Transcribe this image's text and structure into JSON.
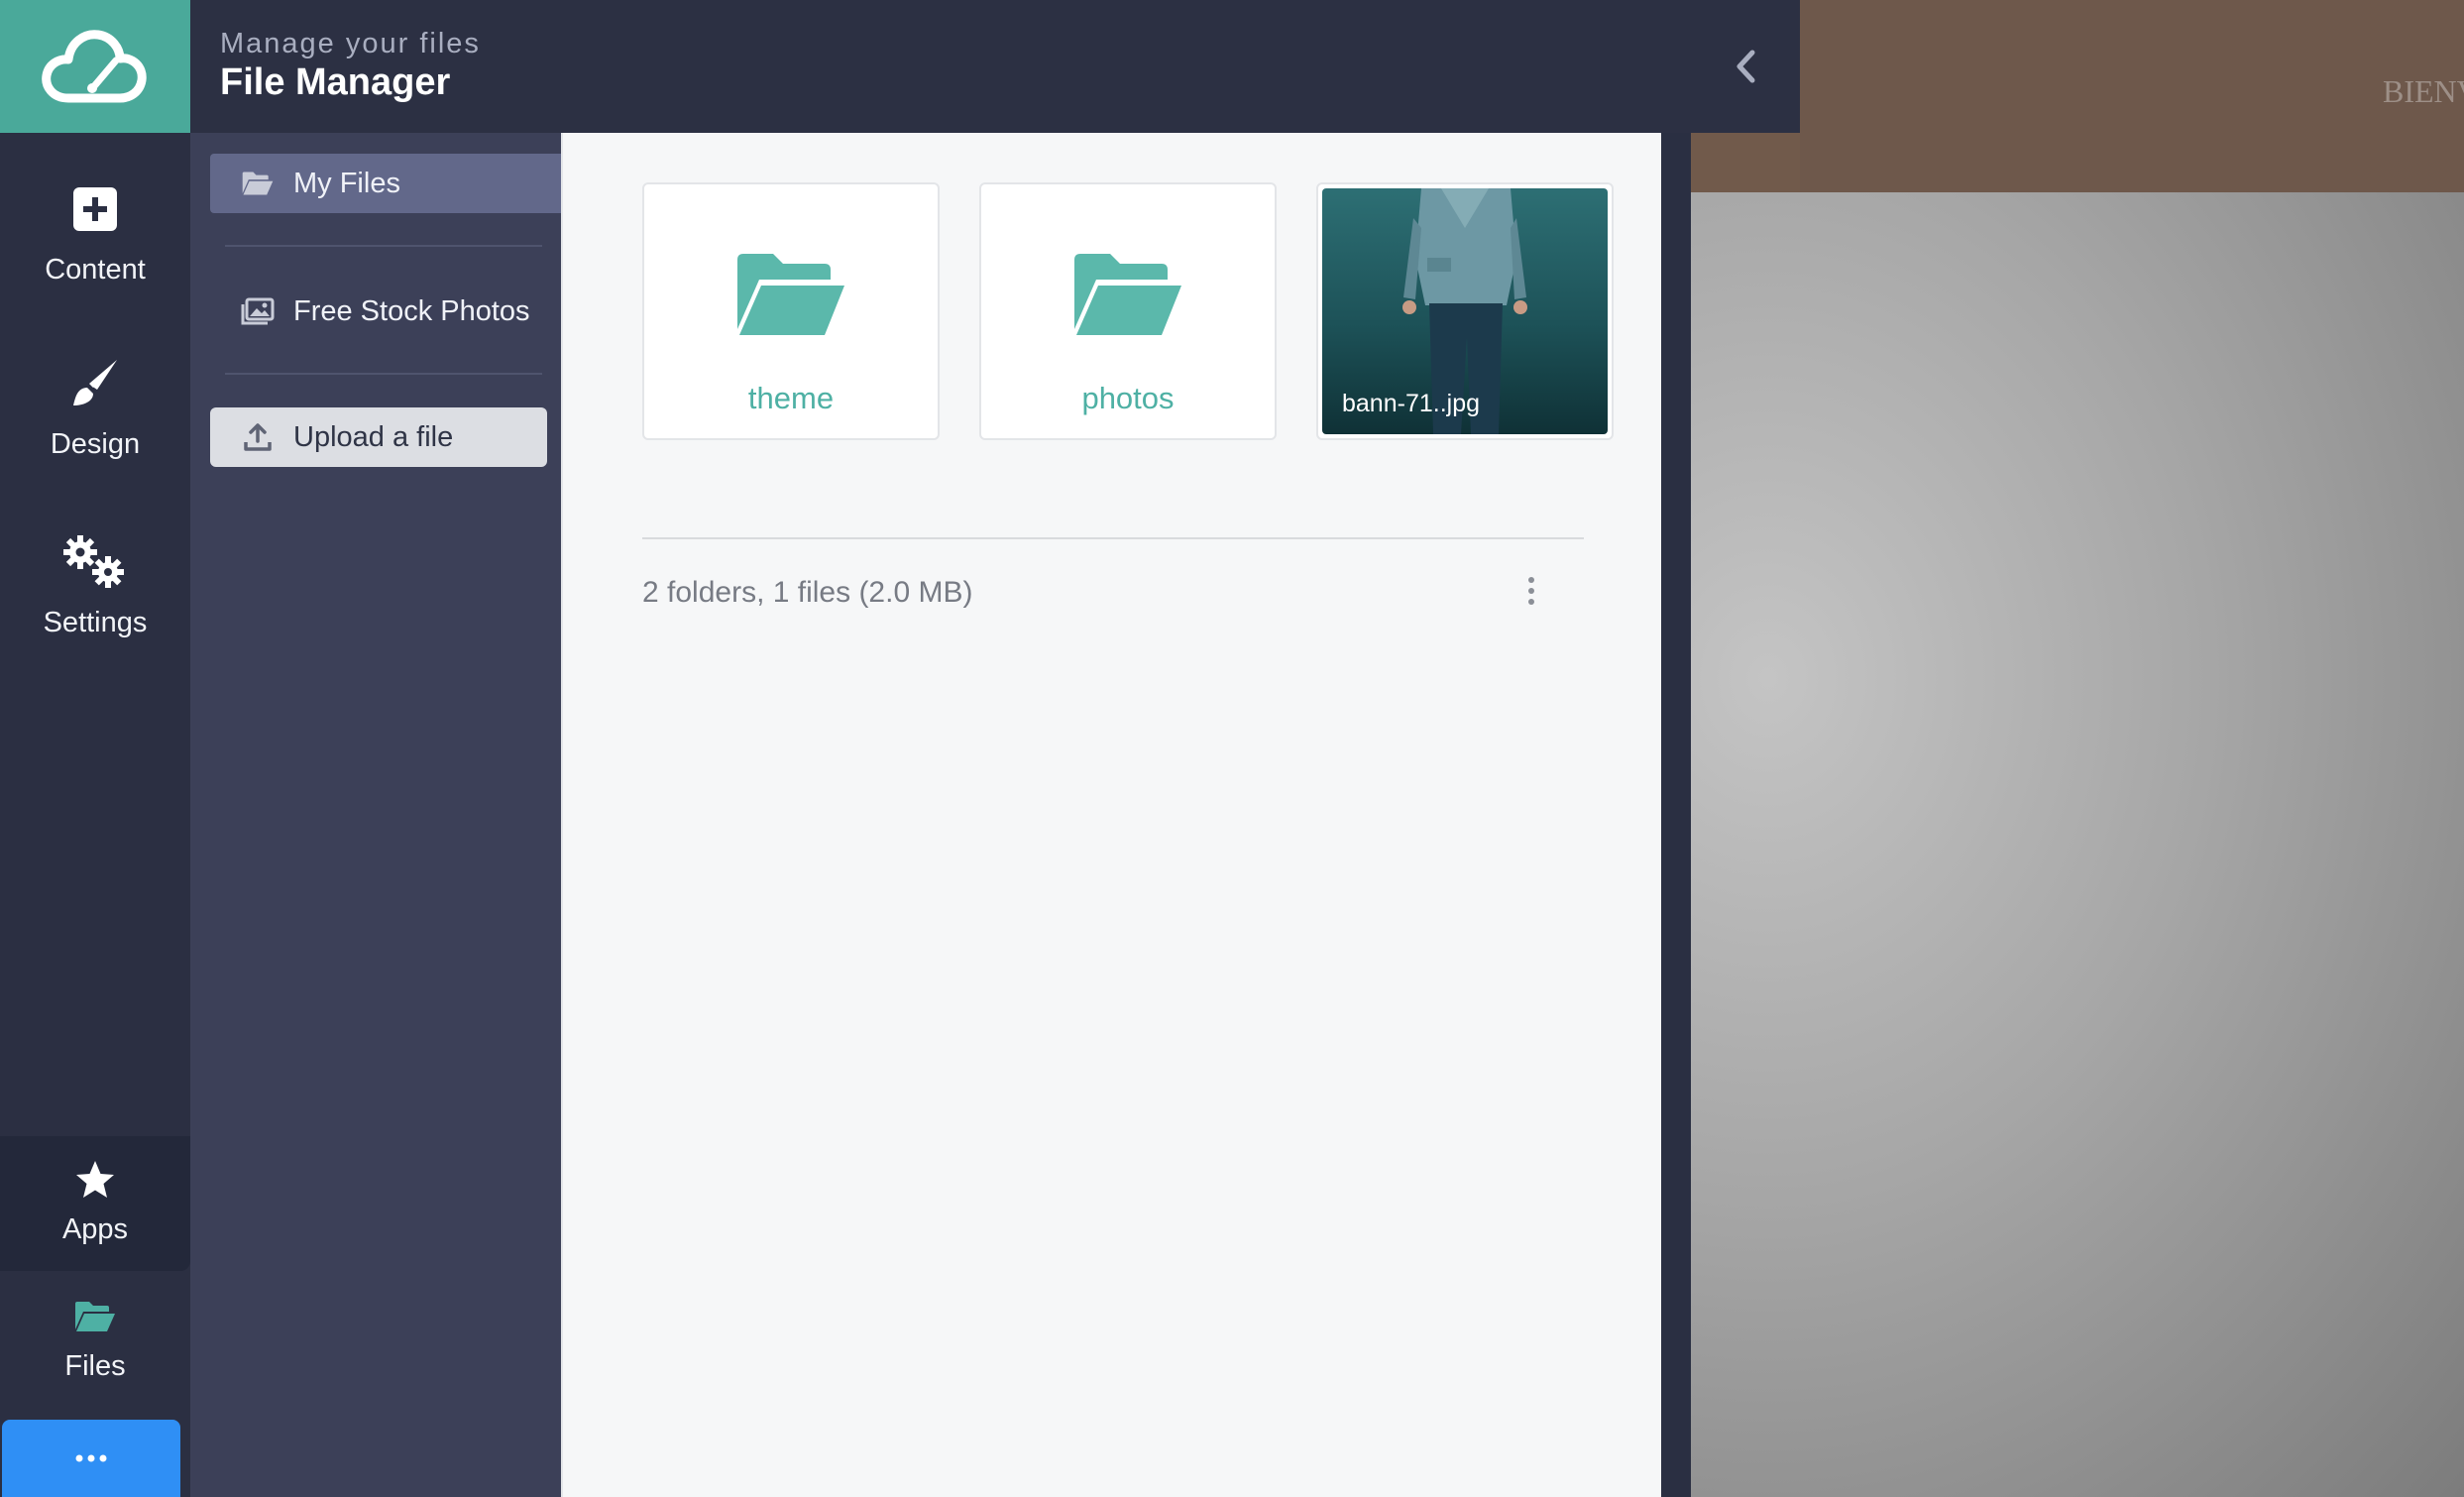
{
  "header": {
    "subtitle": "Manage your files",
    "title": "File Manager"
  },
  "rail": {
    "items": [
      {
        "label": "Content",
        "icon": "plus-square-icon"
      },
      {
        "label": "Design",
        "icon": "paintbrush-icon"
      },
      {
        "label": "Settings",
        "icon": "gears-icon"
      },
      {
        "label": "Apps",
        "icon": "star-icon"
      },
      {
        "label": "Files",
        "icon": "folder-open-icon"
      }
    ],
    "more_label": "..."
  },
  "file_sidebar": {
    "items": [
      {
        "label": "My Files",
        "icon": "folder-open-icon",
        "active": true
      },
      {
        "label": "Free Stock Photos",
        "icon": "images-icon"
      },
      {
        "label": "Upload a file",
        "icon": "upload-icon"
      }
    ]
  },
  "main": {
    "tiles": [
      {
        "type": "folder",
        "name": "theme"
      },
      {
        "type": "folder",
        "name": "photos"
      },
      {
        "type": "image",
        "name": "bann-71..jpg"
      }
    ],
    "summary": "2 folders, 1 files (2.0 MB)"
  },
  "preview": {
    "text": "BIENV"
  },
  "colors": {
    "accent": "#4aa99a",
    "rail_bg": "#2b2f42",
    "sidebar_bg": "#3c4058",
    "active_item": "#62688a",
    "more_button": "#2f8ff5"
  }
}
